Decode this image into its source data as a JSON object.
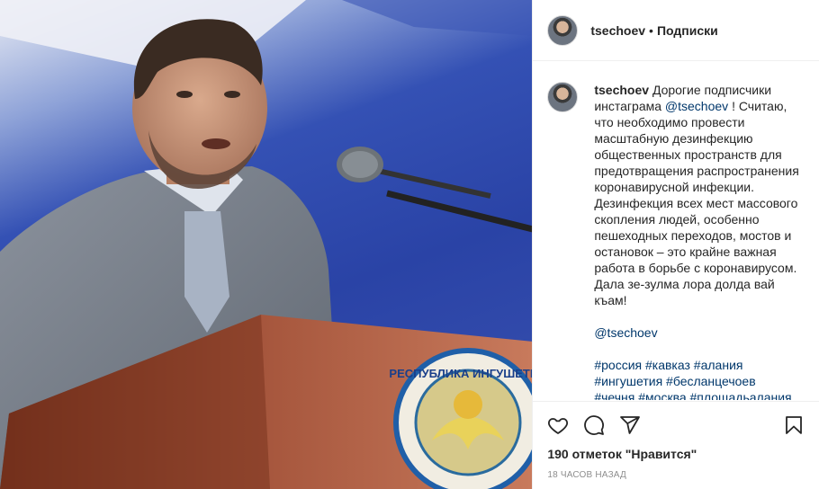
{
  "header": {
    "username": "tsechoev",
    "separator": "•",
    "follow_label": "Подписки"
  },
  "caption": {
    "username": "tsechoev",
    "text_before_mention": "Дорогие подписчики инстаграма",
    "mention": "@tsechoev",
    "text_after_mention": "! Считаю, что необходимо провести масштабную дезинфекцию общественных пространств для предотвращения распространения коронавирусной инфекции. Дезинфекция всех мест массового скопления людей, особенно пешеходных переходов, мостов и остановок – это крайне важная работа в борьбе с коронавирусом. Дала зе-зулма лора долда вай къам!",
    "mention_line": "@tsechoev",
    "hashtags_line1": "#россия #кавказ #алания",
    "hashtags_line2": "#ингушетия #бесланцечоев",
    "hashtags_line3": "#чечня #москва #площадьалания"
  },
  "photo": {
    "emblem_text": "РЕСПУБЛИКА ИНГУШЕТИЯ"
  },
  "actions": {
    "like_icon": "heart-icon",
    "comment_icon": "comment-icon",
    "share_icon": "share-icon",
    "save_icon": "bookmark-icon",
    "likes_text": "190 отметок \"Нравится\"",
    "time_ago": "18 часов назад"
  }
}
